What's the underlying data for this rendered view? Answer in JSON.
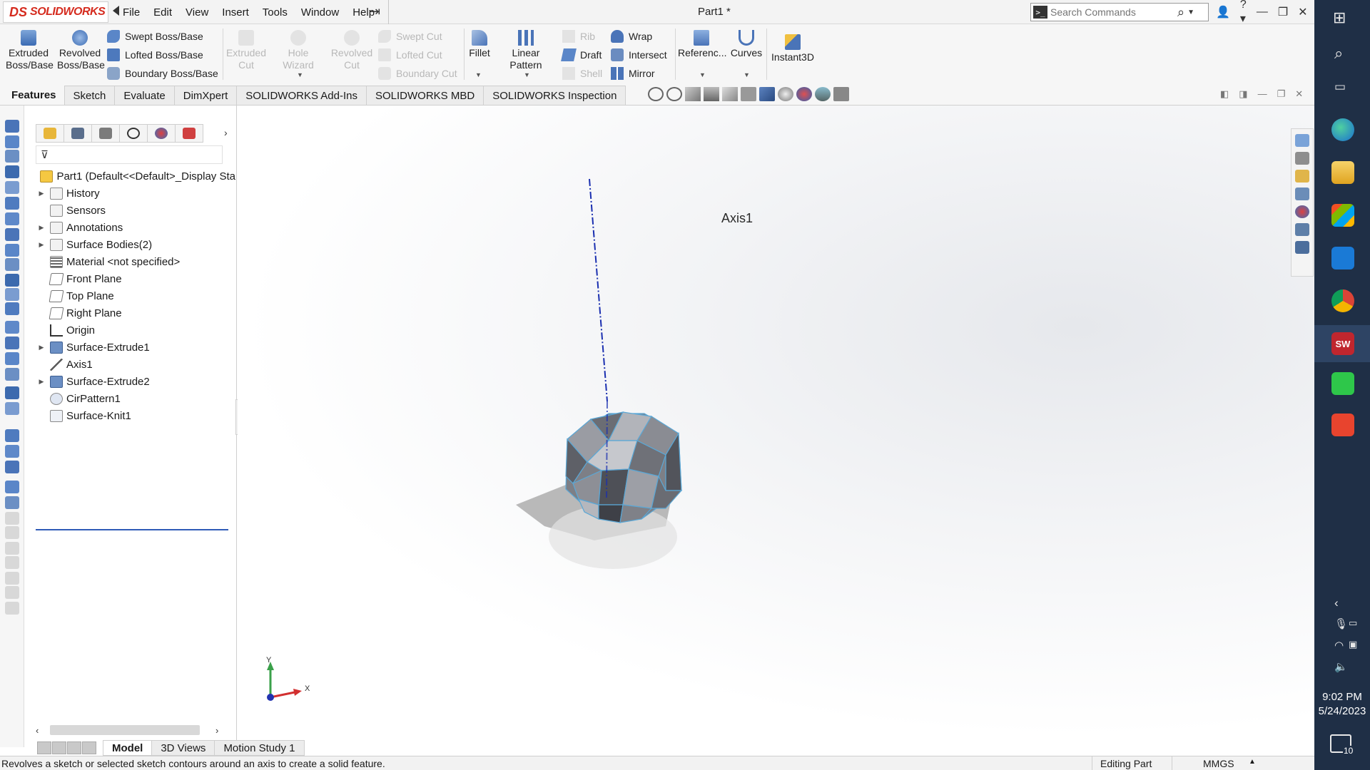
{
  "app": {
    "logo_brand": "DS",
    "logo_text": "SOLIDWORKS",
    "document_title": "Part1 *",
    "menu": [
      "File",
      "Edit",
      "View",
      "Insert",
      "Tools",
      "Window",
      "Help"
    ],
    "search_placeholder": "Search Commands"
  },
  "ribbon": {
    "extruded_boss": "Extruded Boss/Base",
    "revolved_boss": "Revolved Boss/Base",
    "swept_boss": "Swept Boss/Base",
    "lofted_boss": "Lofted Boss/Base",
    "boundary_boss": "Boundary Boss/Base",
    "extruded_cut": "Extruded Cut",
    "hole_wizard": "Hole Wizard",
    "revolved_cut": "Revolved Cut",
    "swept_cut": "Swept Cut",
    "lofted_cut": "Lofted Cut",
    "boundary_cut": "Boundary Cut",
    "fillet": "Fillet",
    "linear_pattern": "Linear Pattern",
    "rib": "Rib",
    "draft": "Draft",
    "shell": "Shell",
    "wrap": "Wrap",
    "intersect": "Intersect",
    "mirror": "Mirror",
    "reference": "Referenc...",
    "curves": "Curves",
    "instant3d": "Instant3D"
  },
  "tabs": [
    "Features",
    "Sketch",
    "Evaluate",
    "DimXpert",
    "SOLIDWORKS Add-Ins",
    "SOLIDWORKS MBD",
    "SOLIDWORKS Inspection"
  ],
  "tree": {
    "root": "Part1  (Default<<Default>_Display Sta",
    "items": [
      {
        "label": "History",
        "expandable": true
      },
      {
        "label": "Sensors",
        "expandable": false
      },
      {
        "label": "Annotations",
        "expandable": true
      },
      {
        "label": "Surface Bodies(2)",
        "expandable": true
      },
      {
        "label": "Material <not specified>",
        "expandable": false
      },
      {
        "label": "Front Plane",
        "expandable": false
      },
      {
        "label": "Top Plane",
        "expandable": false
      },
      {
        "label": "Right Plane",
        "expandable": false
      },
      {
        "label": "Origin",
        "expandable": false
      },
      {
        "label": "Surface-Extrude1",
        "expandable": true
      },
      {
        "label": "Axis1",
        "expandable": false
      },
      {
        "label": "Surface-Extrude2",
        "expandable": true
      },
      {
        "label": "CirPattern1",
        "expandable": false
      },
      {
        "label": "Surface-Knit1",
        "expandable": false
      }
    ]
  },
  "viewport": {
    "axis_label": "Axis1",
    "triad_x": "X",
    "triad_y": "Y"
  },
  "bottom_tabs": [
    "Model",
    "3D Views",
    "Motion Study 1"
  ],
  "status": {
    "message": "Revolves a sketch or selected sketch contours around an axis to create a solid feature.",
    "mode": "Editing Part",
    "units": "MMGS"
  },
  "taskbar": {
    "time": "9:02 PM",
    "date": "5/24/2023",
    "notifications": "10",
    "sw_badge": "SW"
  },
  "colors": {
    "brand_red": "#d52b1e",
    "feature_blue": "#2f5bb7",
    "axis_blue": "#1a2fb0",
    "taskbar_bg": "#1f2f46"
  }
}
